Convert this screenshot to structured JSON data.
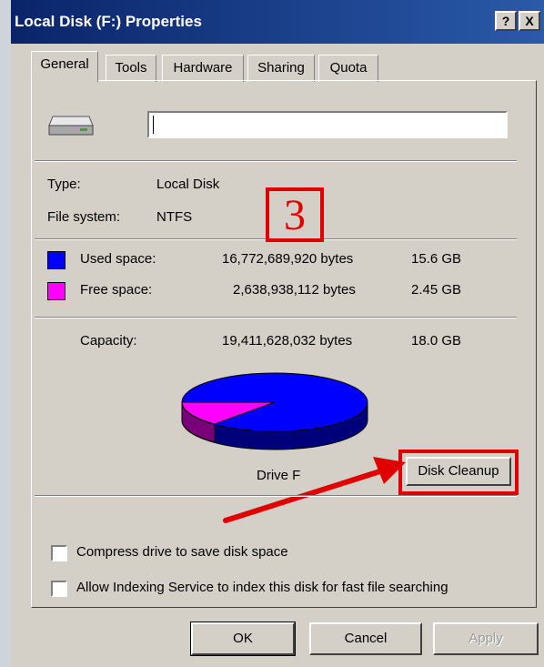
{
  "window": {
    "title": "Local Disk (F:) Properties",
    "help_button": "?",
    "close_button": "X"
  },
  "tabs": [
    "General",
    "Tools",
    "Hardware",
    "Sharing",
    "Quota"
  ],
  "drive_name_value": "",
  "type": {
    "label": "Type:",
    "value": "Local Disk"
  },
  "file_system": {
    "label": "File system:",
    "value": "NTFS"
  },
  "used_space": {
    "label": "Used space:",
    "bytes": "16,772,689,920 bytes",
    "size": "15.6 GB",
    "color": "#0000ff"
  },
  "free_space": {
    "label": "Free space:",
    "bytes": "2,638,938,112 bytes",
    "size": "2.45 GB",
    "color": "#ff00ff"
  },
  "capacity": {
    "label": "Capacity:",
    "bytes": "19,411,628,032 bytes",
    "size": "18.0 GB"
  },
  "pie": {
    "label": "Drive F",
    "used_fraction": 0.864,
    "free_fraction": 0.136
  },
  "disk_cleanup_label": "Disk Cleanup",
  "annotation": {
    "step_number": "3",
    "color": "#e10000"
  },
  "options": {
    "compress": {
      "label": "Compress drive to save disk space",
      "checked": false
    },
    "indexing": {
      "label": "Allow Indexing Service to index this disk for fast file searching",
      "checked": false
    }
  },
  "buttons": {
    "ok": "OK",
    "cancel": "Cancel",
    "apply": "Apply"
  }
}
